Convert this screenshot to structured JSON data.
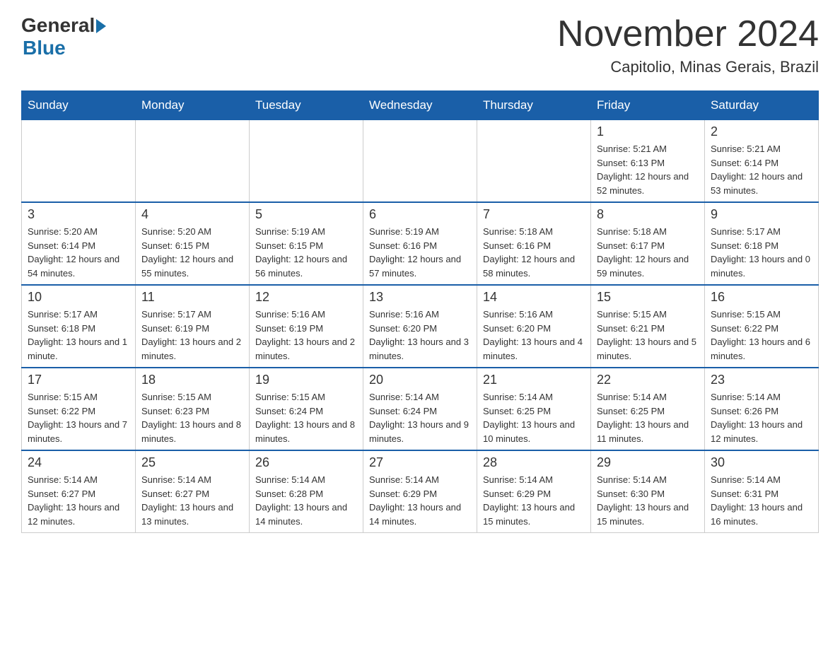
{
  "header": {
    "logo_general": "General",
    "logo_blue": "Blue",
    "month_title": "November 2024",
    "location": "Capitolio, Minas Gerais, Brazil"
  },
  "days_of_week": [
    "Sunday",
    "Monday",
    "Tuesday",
    "Wednesday",
    "Thursday",
    "Friday",
    "Saturday"
  ],
  "weeks": [
    {
      "days": [
        {
          "number": "",
          "info": ""
        },
        {
          "number": "",
          "info": ""
        },
        {
          "number": "",
          "info": ""
        },
        {
          "number": "",
          "info": ""
        },
        {
          "number": "",
          "info": ""
        },
        {
          "number": "1",
          "info": "Sunrise: 5:21 AM\nSunset: 6:13 PM\nDaylight: 12 hours and 52 minutes."
        },
        {
          "number": "2",
          "info": "Sunrise: 5:21 AM\nSunset: 6:14 PM\nDaylight: 12 hours and 53 minutes."
        }
      ]
    },
    {
      "days": [
        {
          "number": "3",
          "info": "Sunrise: 5:20 AM\nSunset: 6:14 PM\nDaylight: 12 hours and 54 minutes."
        },
        {
          "number": "4",
          "info": "Sunrise: 5:20 AM\nSunset: 6:15 PM\nDaylight: 12 hours and 55 minutes."
        },
        {
          "number": "5",
          "info": "Sunrise: 5:19 AM\nSunset: 6:15 PM\nDaylight: 12 hours and 56 minutes."
        },
        {
          "number": "6",
          "info": "Sunrise: 5:19 AM\nSunset: 6:16 PM\nDaylight: 12 hours and 57 minutes."
        },
        {
          "number": "7",
          "info": "Sunrise: 5:18 AM\nSunset: 6:16 PM\nDaylight: 12 hours and 58 minutes."
        },
        {
          "number": "8",
          "info": "Sunrise: 5:18 AM\nSunset: 6:17 PM\nDaylight: 12 hours and 59 minutes."
        },
        {
          "number": "9",
          "info": "Sunrise: 5:17 AM\nSunset: 6:18 PM\nDaylight: 13 hours and 0 minutes."
        }
      ]
    },
    {
      "days": [
        {
          "number": "10",
          "info": "Sunrise: 5:17 AM\nSunset: 6:18 PM\nDaylight: 13 hours and 1 minute."
        },
        {
          "number": "11",
          "info": "Sunrise: 5:17 AM\nSunset: 6:19 PM\nDaylight: 13 hours and 2 minutes."
        },
        {
          "number": "12",
          "info": "Sunrise: 5:16 AM\nSunset: 6:19 PM\nDaylight: 13 hours and 2 minutes."
        },
        {
          "number": "13",
          "info": "Sunrise: 5:16 AM\nSunset: 6:20 PM\nDaylight: 13 hours and 3 minutes."
        },
        {
          "number": "14",
          "info": "Sunrise: 5:16 AM\nSunset: 6:20 PM\nDaylight: 13 hours and 4 minutes."
        },
        {
          "number": "15",
          "info": "Sunrise: 5:15 AM\nSunset: 6:21 PM\nDaylight: 13 hours and 5 minutes."
        },
        {
          "number": "16",
          "info": "Sunrise: 5:15 AM\nSunset: 6:22 PM\nDaylight: 13 hours and 6 minutes."
        }
      ]
    },
    {
      "days": [
        {
          "number": "17",
          "info": "Sunrise: 5:15 AM\nSunset: 6:22 PM\nDaylight: 13 hours and 7 minutes."
        },
        {
          "number": "18",
          "info": "Sunrise: 5:15 AM\nSunset: 6:23 PM\nDaylight: 13 hours and 8 minutes."
        },
        {
          "number": "19",
          "info": "Sunrise: 5:15 AM\nSunset: 6:24 PM\nDaylight: 13 hours and 8 minutes."
        },
        {
          "number": "20",
          "info": "Sunrise: 5:14 AM\nSunset: 6:24 PM\nDaylight: 13 hours and 9 minutes."
        },
        {
          "number": "21",
          "info": "Sunrise: 5:14 AM\nSunset: 6:25 PM\nDaylight: 13 hours and 10 minutes."
        },
        {
          "number": "22",
          "info": "Sunrise: 5:14 AM\nSunset: 6:25 PM\nDaylight: 13 hours and 11 minutes."
        },
        {
          "number": "23",
          "info": "Sunrise: 5:14 AM\nSunset: 6:26 PM\nDaylight: 13 hours and 12 minutes."
        }
      ]
    },
    {
      "days": [
        {
          "number": "24",
          "info": "Sunrise: 5:14 AM\nSunset: 6:27 PM\nDaylight: 13 hours and 12 minutes."
        },
        {
          "number": "25",
          "info": "Sunrise: 5:14 AM\nSunset: 6:27 PM\nDaylight: 13 hours and 13 minutes."
        },
        {
          "number": "26",
          "info": "Sunrise: 5:14 AM\nSunset: 6:28 PM\nDaylight: 13 hours and 14 minutes."
        },
        {
          "number": "27",
          "info": "Sunrise: 5:14 AM\nSunset: 6:29 PM\nDaylight: 13 hours and 14 minutes."
        },
        {
          "number": "28",
          "info": "Sunrise: 5:14 AM\nSunset: 6:29 PM\nDaylight: 13 hours and 15 minutes."
        },
        {
          "number": "29",
          "info": "Sunrise: 5:14 AM\nSunset: 6:30 PM\nDaylight: 13 hours and 15 minutes."
        },
        {
          "number": "30",
          "info": "Sunrise: 5:14 AM\nSunset: 6:31 PM\nDaylight: 13 hours and 16 minutes."
        }
      ]
    }
  ]
}
